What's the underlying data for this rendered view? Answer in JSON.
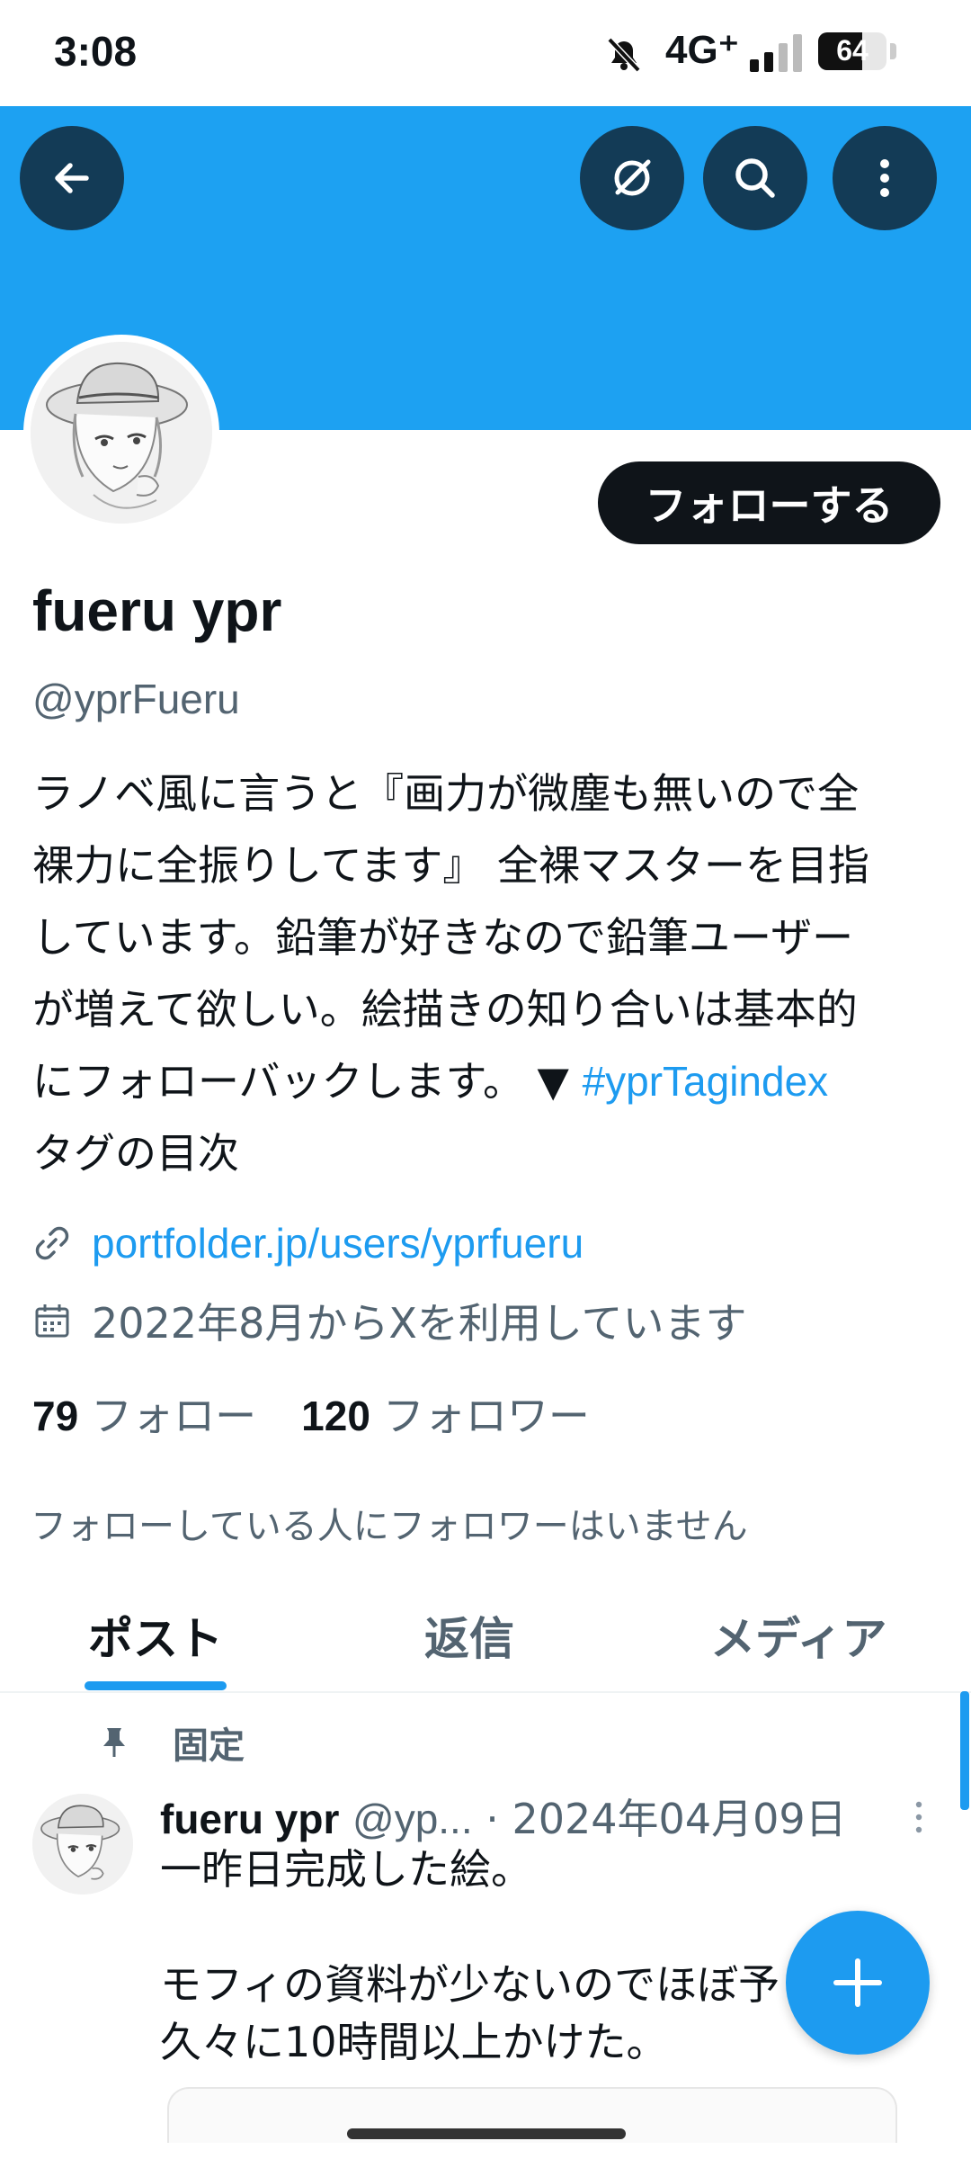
{
  "status_bar": {
    "time": "3:08",
    "network": "4G⁺",
    "battery": "64",
    "battery_level": 0.64
  },
  "profile": {
    "follow_label": "フォローする",
    "name": "fueru ypr",
    "handle": "@yprFueru",
    "bio": {
      "line1": "ラノベ風に言うと『画力が微塵も無いので全",
      "line2": "裸力に全振りしてます』 全裸マスターを目指",
      "line3": "しています。鉛筆が好きなので鉛筆ユーザー",
      "line4": "が増えて欲しい。絵描きの知り合いは基本的",
      "line5_text": "にフォローバックします。 ▼ ",
      "hashtag": "#yprTagindex",
      "line6": "タグの目次"
    },
    "website": "portfolder.jp/users/yprfueru",
    "joined": "2022年8月からXを利用しています",
    "following_count": "79",
    "following_label": "フォロー",
    "followers_count": "120",
    "followers_label": "フォロワー",
    "mutual_note": "フォローしている人にフォロワーはいません"
  },
  "tabs": [
    {
      "label": "ポスト",
      "active": true
    },
    {
      "label": "返信",
      "active": false
    },
    {
      "label": "メディア",
      "active": false
    }
  ],
  "pinned_post": {
    "pinned_label": "固定",
    "author_name": "fueru ypr",
    "author_handle": "@yp...",
    "date": "· 2024年04月09日",
    "line1": "一昨日完成した絵。",
    "line2": "",
    "line3": "モフィの資料が少ないのでほぼ予",
    "line4": "久々に10時間以上かけた。"
  },
  "icons": {
    "back": "arrow-left-icon",
    "grok": "grok-icon",
    "search": "search-icon",
    "more": "more-vertical-icon",
    "link": "link-icon",
    "calendar": "calendar-icon",
    "pin": "pin-icon",
    "compose": "plus-icon"
  },
  "colors": {
    "banner": "#1da1f2",
    "accent": "#1d9bf0",
    "text": "#0f1419",
    "secondary": "#536471"
  }
}
